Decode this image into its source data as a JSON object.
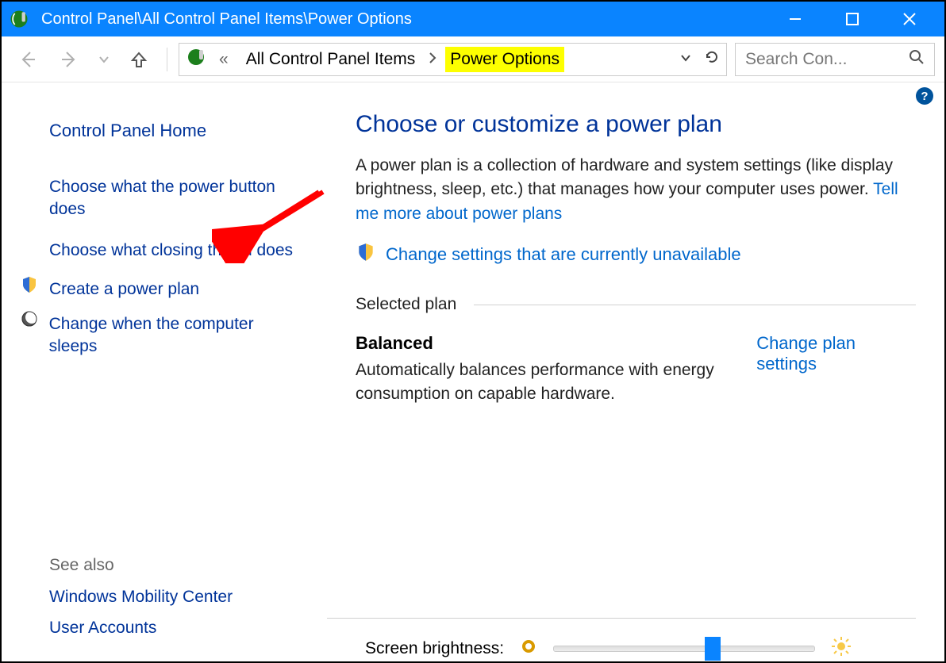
{
  "titlebar": {
    "title": "Control Panel\\All Control Panel Items\\Power Options"
  },
  "nav": {
    "breadcrumb_prefix": "«",
    "breadcrumb_1": "All Control Panel Items",
    "breadcrumb_2": "Power Options"
  },
  "search": {
    "placeholder": "Search Con..."
  },
  "sidebar": {
    "home": "Control Panel Home",
    "links": [
      "Choose what the power button does",
      "Choose what closing the lid does",
      "Create a power plan",
      "Change when the computer sleeps"
    ],
    "see_also_label": "See also",
    "see_also_items": [
      "Windows Mobility Center",
      "User Accounts"
    ]
  },
  "main": {
    "heading": "Choose or customize a power plan",
    "description": "A power plan is a collection of hardware and system settings (like display brightness, sleep, etc.) that manages how your computer uses power. ",
    "more_link": "Tell me more about power plans",
    "change_unavailable": "Change settings that are currently unavailable",
    "section_label": "Selected plan",
    "plan_name": "Balanced",
    "plan_desc": "Automatically balances performance with energy consumption on capable hardware.",
    "plan_settings_link": "Change plan settings",
    "brightness_label": "Screen brightness:"
  },
  "help_badge": "?"
}
